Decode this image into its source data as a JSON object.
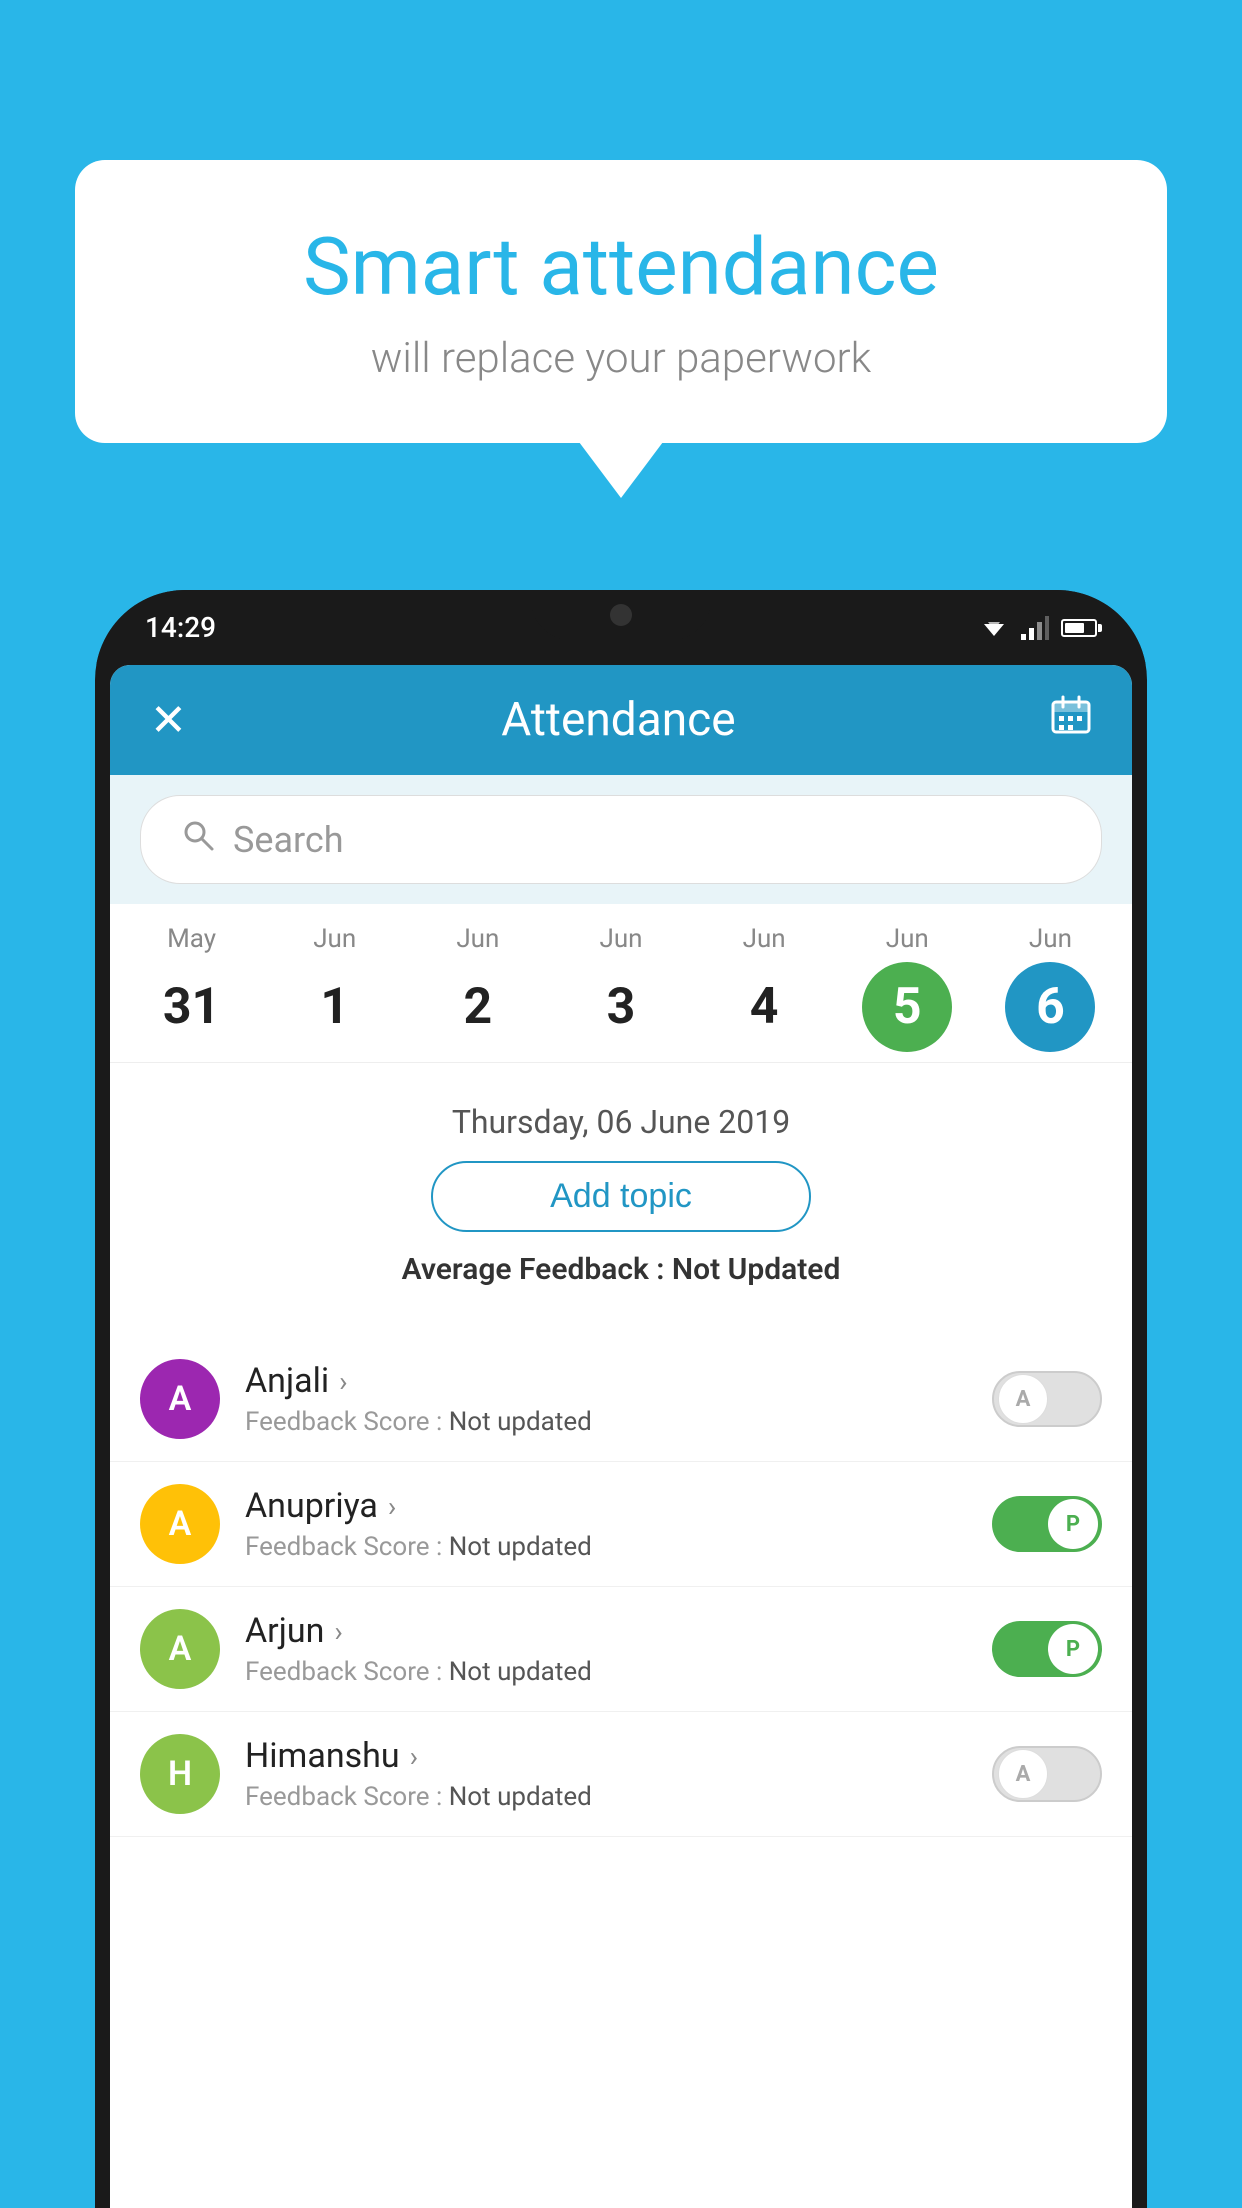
{
  "background_color": "#29b6e8",
  "speech_bubble": {
    "title": "Smart attendance",
    "subtitle": "will replace your paperwork"
  },
  "phone": {
    "status_bar": {
      "time": "14:29"
    },
    "app_bar": {
      "title": "Attendance",
      "close_label": "✕",
      "calendar_label": "📅"
    },
    "search": {
      "placeholder": "Search"
    },
    "calendar": {
      "days": [
        {
          "month": "May",
          "date": "31",
          "state": "normal"
        },
        {
          "month": "Jun",
          "date": "1",
          "state": "normal"
        },
        {
          "month": "Jun",
          "date": "2",
          "state": "normal"
        },
        {
          "month": "Jun",
          "date": "3",
          "state": "normal"
        },
        {
          "month": "Jun",
          "date": "4",
          "state": "normal"
        },
        {
          "month": "Jun",
          "date": "5",
          "state": "today"
        },
        {
          "month": "Jun",
          "date": "6",
          "state": "selected"
        }
      ]
    },
    "selected_date_label": "Thursday, 06 June 2019",
    "add_topic_label": "Add topic",
    "avg_feedback_label": "Average Feedback :",
    "avg_feedback_value": "Not Updated",
    "students": [
      {
        "name": "Anjali",
        "initial": "A",
        "avatar_color": "#9c27b0",
        "feedback_label": "Feedback Score :",
        "feedback_value": "Not updated",
        "toggle": "off",
        "toggle_letter": "A"
      },
      {
        "name": "Anupriya",
        "initial": "A",
        "avatar_color": "#ffc107",
        "feedback_label": "Feedback Score :",
        "feedback_value": "Not updated",
        "toggle": "on",
        "toggle_letter": "P"
      },
      {
        "name": "Arjun",
        "initial": "A",
        "avatar_color": "#8bc34a",
        "feedback_label": "Feedback Score :",
        "feedback_value": "Not updated",
        "toggle": "on",
        "toggle_letter": "P"
      },
      {
        "name": "Himanshu",
        "initial": "H",
        "avatar_color": "#8bc34a",
        "feedback_label": "Feedback Score :",
        "feedback_value": "Not updated",
        "toggle": "off",
        "toggle_letter": "A"
      }
    ]
  }
}
